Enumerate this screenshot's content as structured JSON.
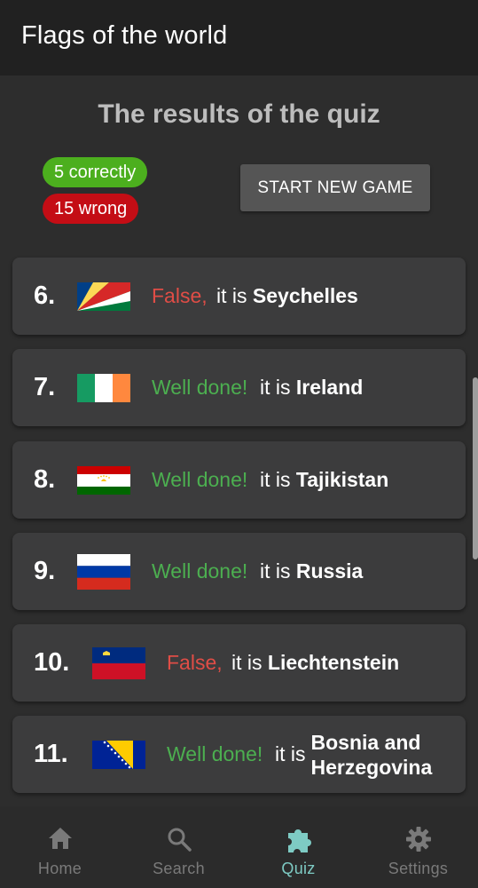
{
  "app": {
    "title": "Flags of the world"
  },
  "results": {
    "title": "The results of the quiz",
    "correct_label": "5 correctly",
    "wrong_label": "15 wrong",
    "new_game_label": "START NEW GAME"
  },
  "answers": [
    {
      "number": "6.",
      "verdict": "False,",
      "prefix": "it is",
      "country": "Seychelles",
      "correct": false,
      "flag_icon": "seychelles-flag-icon"
    },
    {
      "number": "7.",
      "verdict": "Well done!",
      "prefix": "it is",
      "country": "Ireland",
      "correct": true,
      "flag_icon": "ireland-flag-icon"
    },
    {
      "number": "8.",
      "verdict": "Well done!",
      "prefix": "it is",
      "country": "Tajikistan",
      "correct": true,
      "flag_icon": "tajikistan-flag-icon"
    },
    {
      "number": "9.",
      "verdict": "Well done!",
      "prefix": "it is",
      "country": "Russia",
      "correct": true,
      "flag_icon": "russia-flag-icon"
    },
    {
      "number": "10.",
      "verdict": "False,",
      "prefix": "it is",
      "country": "Liechtenstein",
      "correct": false,
      "flag_icon": "liechtenstein-flag-icon"
    },
    {
      "number": "11.",
      "verdict": "Well done!",
      "prefix": "it is",
      "country": "Bosnia and Herzegovina",
      "correct": true,
      "flag_icon": "bosnia-flag-icon"
    }
  ],
  "nav": {
    "items": [
      {
        "label": "Home",
        "icon": "home-icon"
      },
      {
        "label": "Search",
        "icon": "search-icon"
      },
      {
        "label": "Quiz",
        "icon": "puzzle-icon",
        "active": true
      },
      {
        "label": "Settings",
        "icon": "gear-icon"
      }
    ]
  },
  "colors": {
    "correct": "#4caf1e",
    "wrong": "#c40d15",
    "false_text": "#e04d46",
    "ok_text": "#4caf50",
    "active_nav": "#7ecbc4",
    "card": "#3c3c3d",
    "background": "#2d2d2d"
  }
}
